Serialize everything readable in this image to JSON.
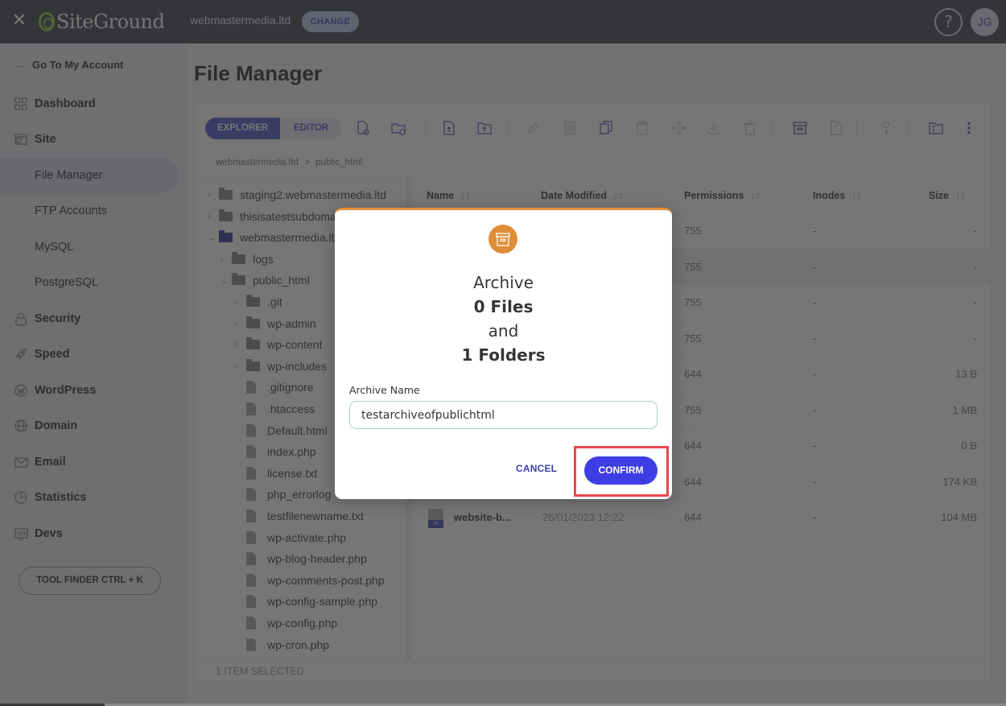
{
  "topbar": {
    "close_icon": "close-icon",
    "brand": "SiteGround",
    "domain": "webmastermedia.ltd",
    "change_label": "CHANGE",
    "help_label": "?",
    "avatar_initials": "JG"
  },
  "sidebar": {
    "back_label": "Go To My Account",
    "items": [
      {
        "label": "Dashboard",
        "icon": "dashboard-grid-icon",
        "type": "section"
      },
      {
        "label": "Site",
        "icon": "site-icon",
        "type": "section"
      },
      {
        "label": "File Manager",
        "type": "sub",
        "active": true
      },
      {
        "label": "FTP Accounts",
        "type": "sub"
      },
      {
        "label": "MySQL",
        "type": "sub"
      },
      {
        "label": "PostgreSQL",
        "type": "sub"
      },
      {
        "label": "Security",
        "icon": "lock-icon",
        "type": "section"
      },
      {
        "label": "Speed",
        "icon": "rocket-icon",
        "type": "section"
      },
      {
        "label": "WordPress",
        "icon": "wordpress-icon",
        "type": "section"
      },
      {
        "label": "Domain",
        "icon": "globe-icon",
        "type": "section"
      },
      {
        "label": "Email",
        "icon": "envelope-icon",
        "type": "section"
      },
      {
        "label": "Statistics",
        "icon": "pie-chart-icon",
        "type": "section"
      },
      {
        "label": "Devs",
        "icon": "code-icon",
        "type": "section"
      }
    ],
    "tool_finder_label": "TOOL FINDER CTRL + K"
  },
  "main": {
    "title": "File Manager",
    "tabs": [
      {
        "label": "EXPLORER",
        "active": true
      },
      {
        "label": "EDITOR",
        "active": false
      }
    ],
    "breadcrumb": [
      "webmastermedia.ltd",
      ">",
      "public_html"
    ],
    "tree": [
      {
        "label": "staging2.webmastermedia.ltd",
        "type": "folder",
        "level": 0,
        "expanded": false
      },
      {
        "label": "thisisatestsubdomain",
        "type": "folder",
        "level": 0,
        "expanded": false
      },
      {
        "label": "webmastermedia.ltd",
        "type": "folder",
        "level": 0,
        "expanded": true,
        "highlight": true
      },
      {
        "label": "logs",
        "type": "folder",
        "level": 1,
        "expanded": false
      },
      {
        "label": "public_html",
        "type": "folder",
        "level": 1,
        "expanded": true
      },
      {
        "label": ".git",
        "type": "folder",
        "level": 2,
        "expanded": false
      },
      {
        "label": "wp-admin",
        "type": "folder",
        "level": 2,
        "expanded": false
      },
      {
        "label": "wp-content",
        "type": "folder",
        "level": 2,
        "expanded": false
      },
      {
        "label": "wp-includes",
        "type": "folder",
        "level": 2,
        "expanded": false
      },
      {
        "label": ".gitignore",
        "type": "file",
        "level": 2
      },
      {
        "label": ".htaccess",
        "type": "file",
        "level": 2
      },
      {
        "label": "Default.html",
        "type": "file",
        "level": 2
      },
      {
        "label": "index.php",
        "type": "file",
        "level": 2
      },
      {
        "label": "license.txt",
        "type": "file",
        "level": 2
      },
      {
        "label": "php_errorlog",
        "type": "file",
        "level": 2
      },
      {
        "label": "testfilenewname.txt",
        "type": "file",
        "level": 2
      },
      {
        "label": "wp-activate.php",
        "type": "file",
        "level": 2
      },
      {
        "label": "wp-blog-header.php",
        "type": "file",
        "level": 2
      },
      {
        "label": "wp-comments-post.php",
        "type": "file",
        "level": 2
      },
      {
        "label": "wp-config-sample.php",
        "type": "file",
        "level": 2
      },
      {
        "label": "wp-config.php",
        "type": "file",
        "level": 2
      },
      {
        "label": "wp-cron.php",
        "type": "file",
        "level": 2
      }
    ],
    "columns": [
      "Name",
      "Date Modified",
      "Permissions",
      "Inodes",
      "Size"
    ],
    "rows": [
      {
        "name": "",
        "date": "",
        "permissions": "755",
        "inodes": "-",
        "size": "-"
      },
      {
        "name": "",
        "date": "",
        "permissions": "755",
        "inodes": "-",
        "size": "-",
        "selected": true
      },
      {
        "name": "",
        "date": "",
        "permissions": "755",
        "inodes": "-",
        "size": "-"
      },
      {
        "name": "",
        "date": "",
        "permissions": "755",
        "inodes": "-",
        "size": "-"
      },
      {
        "name": "",
        "date": "",
        "permissions": "644",
        "inodes": "-",
        "size": "13 B"
      },
      {
        "name": "",
        "date": "",
        "permissions": "755",
        "inodes": "-",
        "size": "1 MB"
      },
      {
        "name": "",
        "date": "",
        "permissions": "644",
        "inodes": "-",
        "size": "0 B"
      },
      {
        "name": "",
        "date": "",
        "permissions": "644",
        "inodes": "-",
        "size": "174 KB"
      },
      {
        "name": "website-b...",
        "date": "26/01/2023 12:22",
        "permissions": "644",
        "inodes": "-",
        "size": "104 MB",
        "icon": "zip-file-icon"
      }
    ],
    "status": "1 ITEM SELECTED"
  },
  "modal": {
    "icon": "archive-box-icon",
    "accent": "#e08e35",
    "line1": "Archive",
    "line2": "0 Files",
    "line3": "and",
    "line4": "1 Folders",
    "field_label": "Archive Name",
    "field_value": "testarchiveofpublichtml",
    "cancel_label": "CANCEL",
    "confirm_label": "CONFIRM",
    "confirm_color": "#3f3de6",
    "highlight_color": "#e8484d"
  }
}
